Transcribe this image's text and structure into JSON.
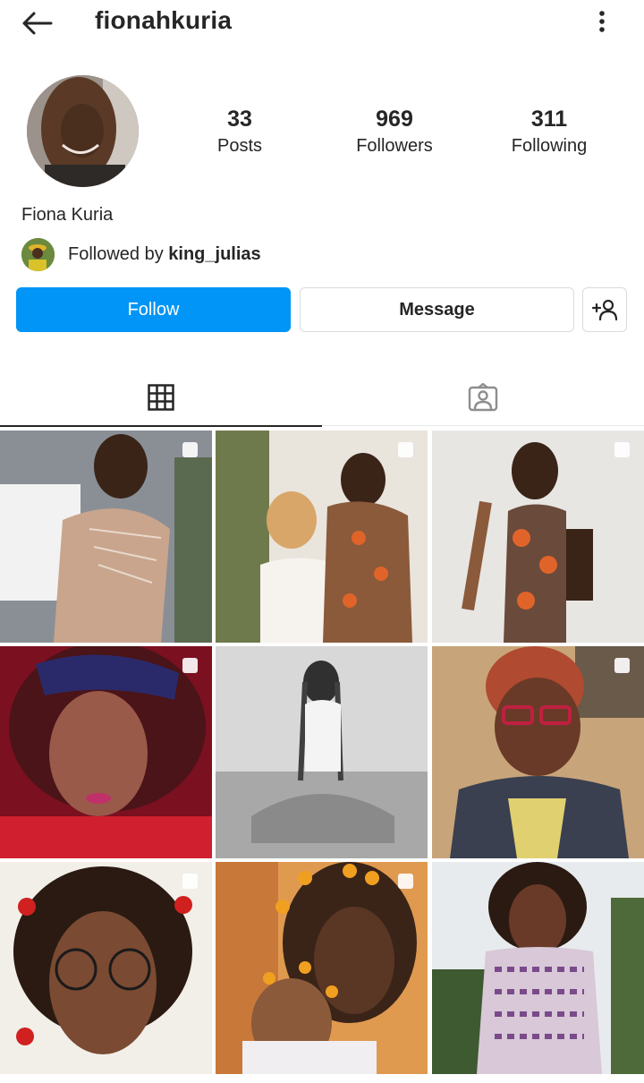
{
  "header": {
    "username": "fionahkuria",
    "back_icon": "arrow-left-icon",
    "more_icon": "more-vertical-icon"
  },
  "profile": {
    "full_name": "Fiona Kuria",
    "stats": {
      "posts": {
        "count": "33",
        "label": "Posts"
      },
      "followers": {
        "count": "969",
        "label": "Followers"
      },
      "following": {
        "count": "311",
        "label": "Following"
      }
    },
    "followed_by": {
      "prefix": "Followed by ",
      "user": "king_julias"
    }
  },
  "actions": {
    "follow_label": "Follow",
    "message_label": "Message",
    "add_user_icon": "add-person-icon"
  },
  "tabs": [
    {
      "icon": "grid-icon",
      "active": true
    },
    {
      "icon": "tagged-person-icon",
      "active": false
    }
  ],
  "colors": {
    "accent": "#0095f6",
    "text": "#262626",
    "border": "#dbdbdb"
  }
}
